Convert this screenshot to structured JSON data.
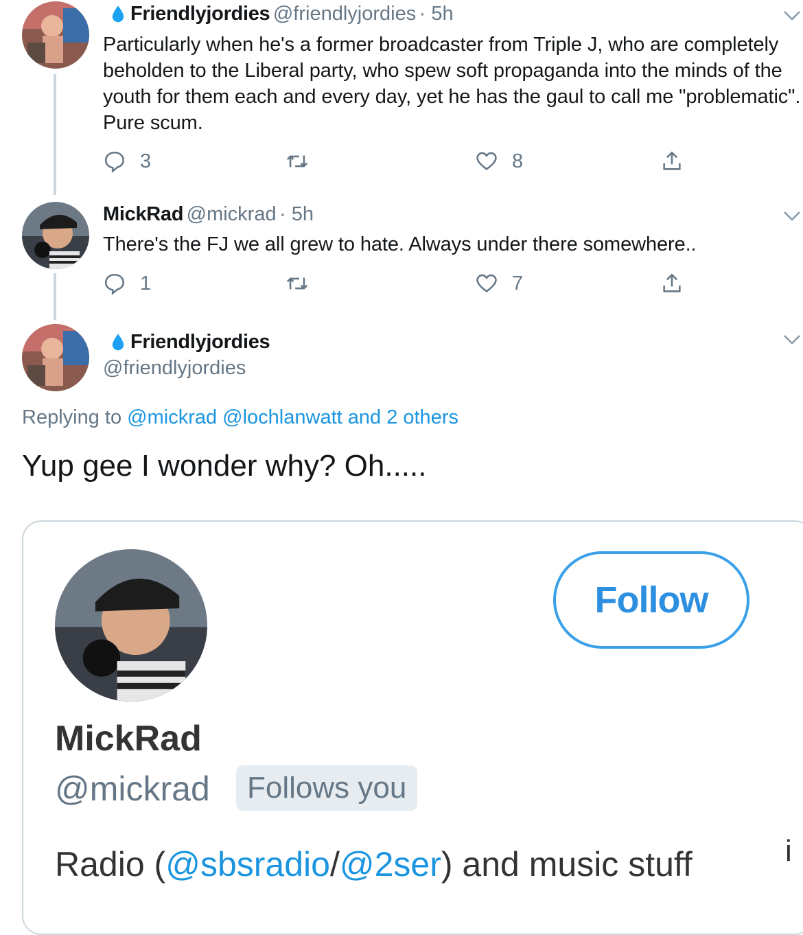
{
  "tweets": [
    {
      "name": "Friendlyjordies",
      "handle": "@friendlyjordies",
      "time": "· 5h",
      "text": "Particularly when he's a former broadcaster from Triple J, who are completely beholden to the Liberal party, who spew soft propaganda into the minds of the youth for them each and every day, yet he has the gaul to call me \"problematic\". Pure  scum.",
      "replies": "3",
      "retweets": "",
      "likes": "8"
    },
    {
      "name": "MickRad",
      "handle": "@mickrad",
      "time": "· 5h",
      "text": "There's the FJ we all grew to hate. Always under there somewhere..",
      "replies": "1",
      "retweets": "",
      "likes": "7"
    }
  ],
  "main_tweet": {
    "name": "Friendlyjordies",
    "handle": "@friendlyjordies",
    "replying_prefix": "Replying to",
    "replying_to": "@mickrad @lochlanwatt and 2 others",
    "text": "Yup gee I wonder why? Oh.....",
    "embedded_card": {
      "follow_label": "Follow",
      "name": "MickRad",
      "handle": "@mickrad",
      "follows_badge": "Follows you",
      "bio_prefix": "Radio (",
      "bio_link1": "@sbsradio",
      "bio_sep": "/",
      "bio_link2": "@2ser",
      "bio_suffix": ") and music stuff",
      "edge_text": "i"
    }
  },
  "colors": {
    "accent": "#1b95e0",
    "muted": "#657786",
    "verified_drop": "#1da1f2"
  },
  "icons": [
    "water-drop-icon",
    "reply-icon",
    "retweet-icon",
    "like-icon",
    "share-icon",
    "chevron-down-icon"
  ]
}
